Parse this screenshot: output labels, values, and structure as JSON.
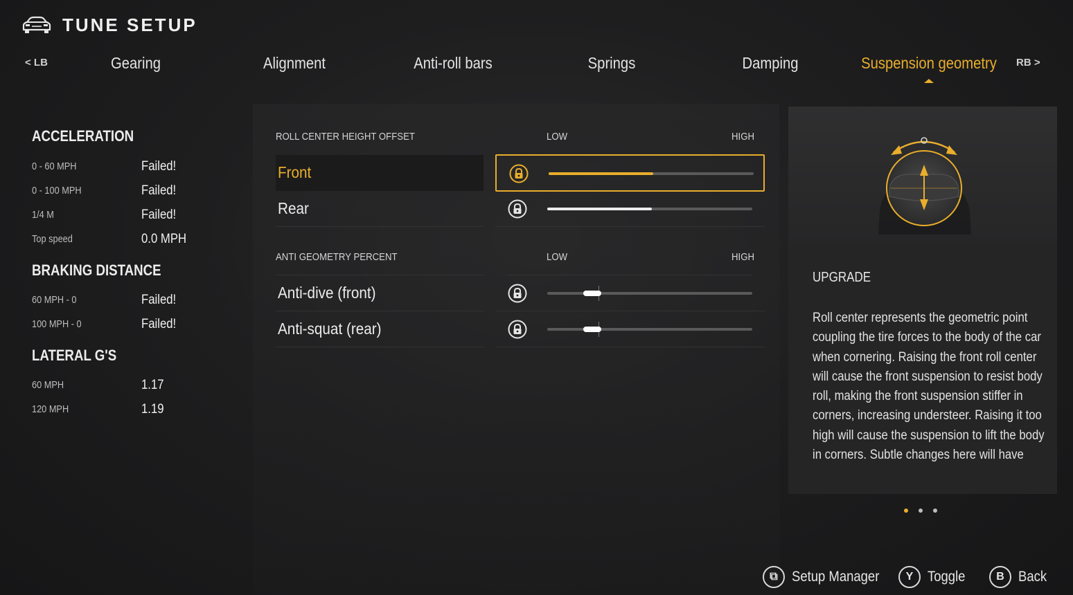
{
  "header": {
    "title": "TUNE SETUP",
    "icon": "car-icon"
  },
  "tabs": {
    "left_bumper": "< LB",
    "right_bumper": "RB >",
    "items": [
      {
        "label": "Gearing"
      },
      {
        "label": "Alignment"
      },
      {
        "label": "Anti-roll bars"
      },
      {
        "label": "Springs"
      },
      {
        "label": "Damping"
      },
      {
        "label": "Suspension geometry",
        "active": true
      }
    ]
  },
  "stats": {
    "acceleration": {
      "heading": "ACCELERATION",
      "rows": [
        {
          "label": "0 - 60 MPH",
          "value": "Failed!"
        },
        {
          "label": "0 - 100 MPH",
          "value": "Failed!"
        },
        {
          "label": "1/4 M",
          "value": "Failed!"
        },
        {
          "label": "Top speed",
          "value": "0.0 MPH"
        }
      ]
    },
    "braking": {
      "heading": "BRAKING DISTANCE",
      "rows": [
        {
          "label": "60 MPH - 0",
          "value": "Failed!"
        },
        {
          "label": "100 MPH - 0",
          "value": "Failed!"
        }
      ]
    },
    "lateral": {
      "heading": "LATERAL G'S",
      "rows": [
        {
          "label": "60 MPH",
          "value": "1.17"
        },
        {
          "label": "120 MPH",
          "value": "1.19"
        }
      ]
    }
  },
  "settings": {
    "roll_center": {
      "label": "ROLL CENTER HEIGHT OFFSET",
      "low": "LOW",
      "high": "HIGH",
      "rows": [
        {
          "name": "Front",
          "locked": true,
          "level": 0.51,
          "selected": true
        },
        {
          "name": "Rear",
          "locked": true,
          "level": 0.51
        }
      ]
    },
    "anti_geometry": {
      "label": "ANTI GEOMETRY PERCENT",
      "low": "LOW",
      "high": "HIGH",
      "rows": [
        {
          "name": "Anti-dive (front)",
          "locked": true,
          "level": 0.22,
          "default": 0.25
        },
        {
          "name": "Anti-squat (rear)",
          "locked": true,
          "level": 0.22,
          "default": 0.25
        }
      ]
    }
  },
  "info": {
    "heading": "UPGRADE",
    "body": "Roll center represents the geometric point coupling the tire forces to the body of the car when cornering. Raising the front roll center will cause the front suspension to resist body roll, making the front suspension stiffer in corners, increasing understeer. Raising it too high will cause the suspension to lift the body in corners. Subtle changes here will have",
    "page_count": 3,
    "page_active": 1
  },
  "footer": {
    "setup_manager": {
      "icon": "⧉",
      "label": "Setup Manager"
    },
    "toggle": {
      "icon": "Y",
      "label": "Toggle"
    },
    "back": {
      "icon": "B",
      "label": "Back"
    }
  },
  "colors": {
    "accent": "#e9ae2b",
    "background": "#1e1e1f",
    "text": "#e6e6e6"
  }
}
